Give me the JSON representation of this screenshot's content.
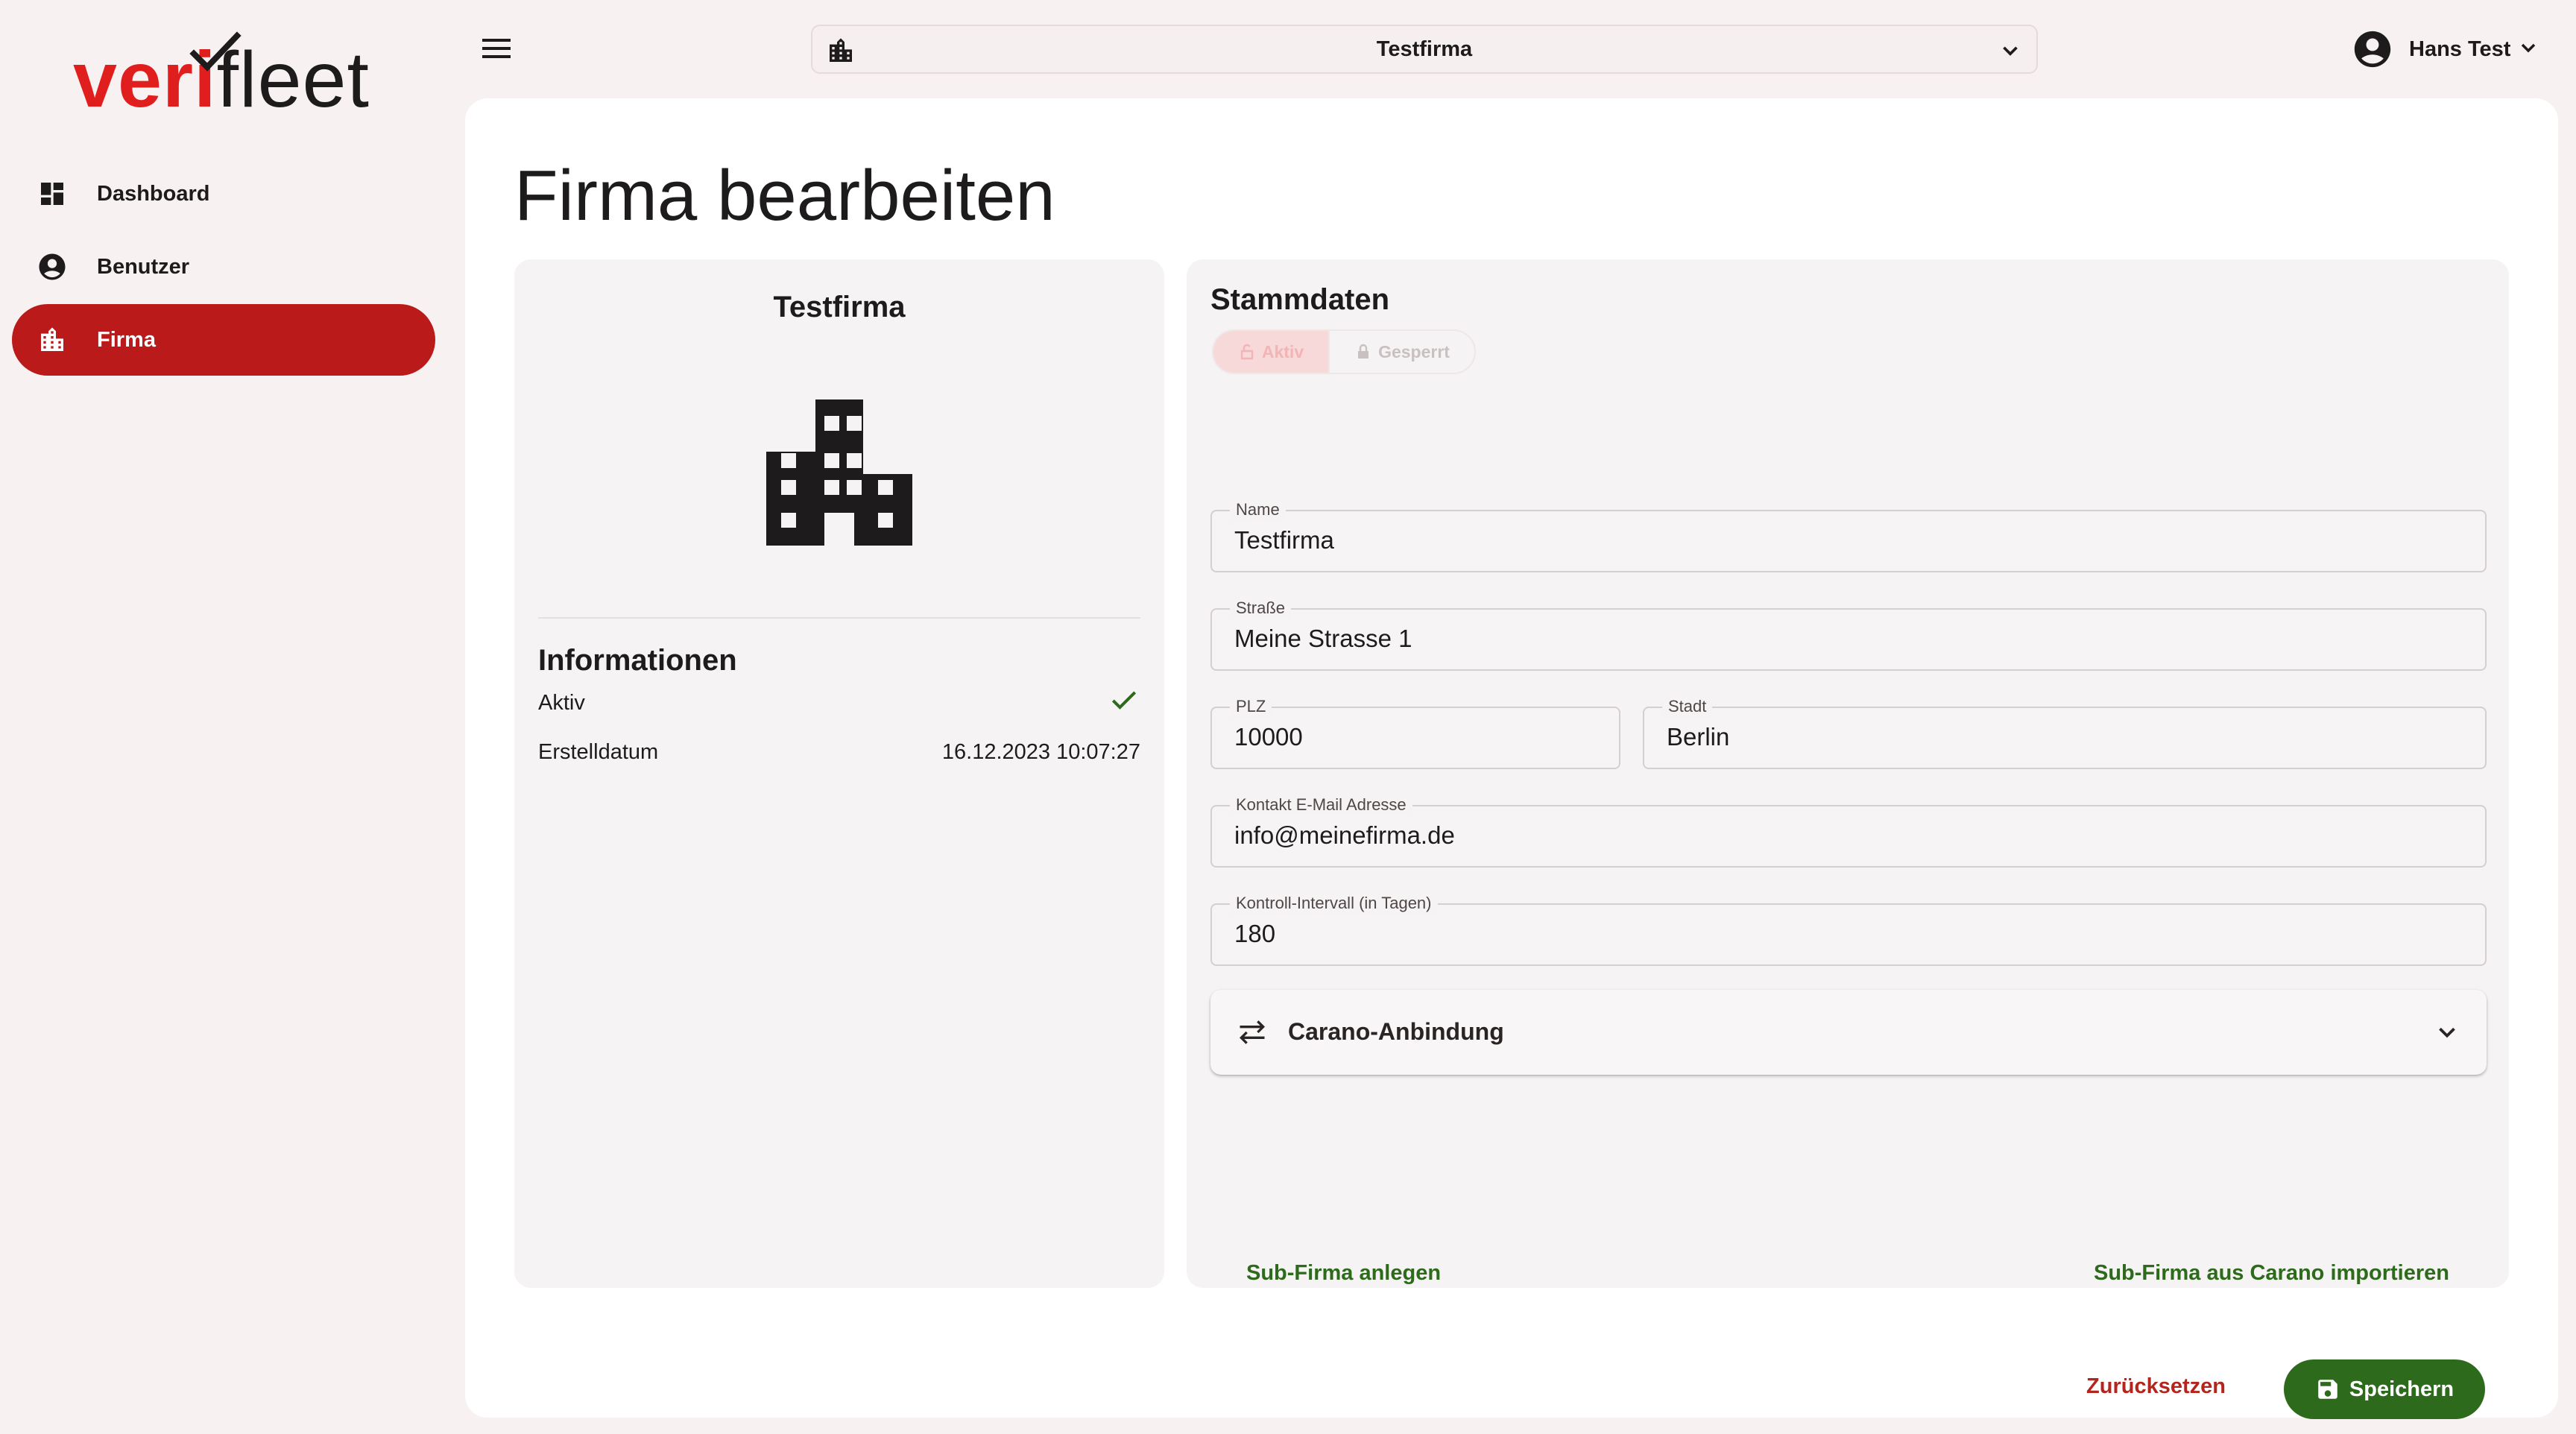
{
  "brand": {
    "logo_part1": "veri",
    "logo_part2": "fleet"
  },
  "sidebar": {
    "items": [
      {
        "label": "Dashboard",
        "icon": "dashboard-icon",
        "active": false
      },
      {
        "label": "Benutzer",
        "icon": "account-circle-icon",
        "active": false
      },
      {
        "label": "Firma",
        "icon": "building-icon",
        "active": true
      }
    ]
  },
  "topbar": {
    "company_selector": "Testfirma",
    "user_name": "Hans Test"
  },
  "page": {
    "title": "Firma bearbeiten"
  },
  "company_card": {
    "title": "Testfirma",
    "info_title": "Informationen",
    "active_label": "Aktiv",
    "created_label": "Erstelldatum",
    "created_value": "16.12.2023 10:07:27"
  },
  "master_data": {
    "title": "Stammdaten",
    "status_active": "Aktiv",
    "status_locked": "Gesperrt",
    "fields": {
      "name": {
        "label": "Name",
        "value": "Testfirma"
      },
      "street": {
        "label": "Straße",
        "value": "Meine Strasse 1"
      },
      "zip": {
        "label": "PLZ",
        "value": "10000"
      },
      "city": {
        "label": "Stadt",
        "value": "Berlin"
      },
      "email": {
        "label": "Kontakt E-Mail Adresse",
        "value": "info@meinefirma.de"
      },
      "interval": {
        "label": "Kontroll-Intervall (in Tagen)",
        "value": "180"
      }
    },
    "carano_label": "Carano-Anbindung",
    "sub_company_create": "Sub-Firma anlegen",
    "sub_company_import": "Sub-Firma aus Carano importieren",
    "reset_label": "Zurücksetzen",
    "save_label": "Speichern"
  },
  "colors": {
    "primary": "#ba1a1a",
    "success": "#2d6a1b",
    "background": "#f8f1f1",
    "surface": "#ffffff",
    "card": "#f5f3f3"
  }
}
